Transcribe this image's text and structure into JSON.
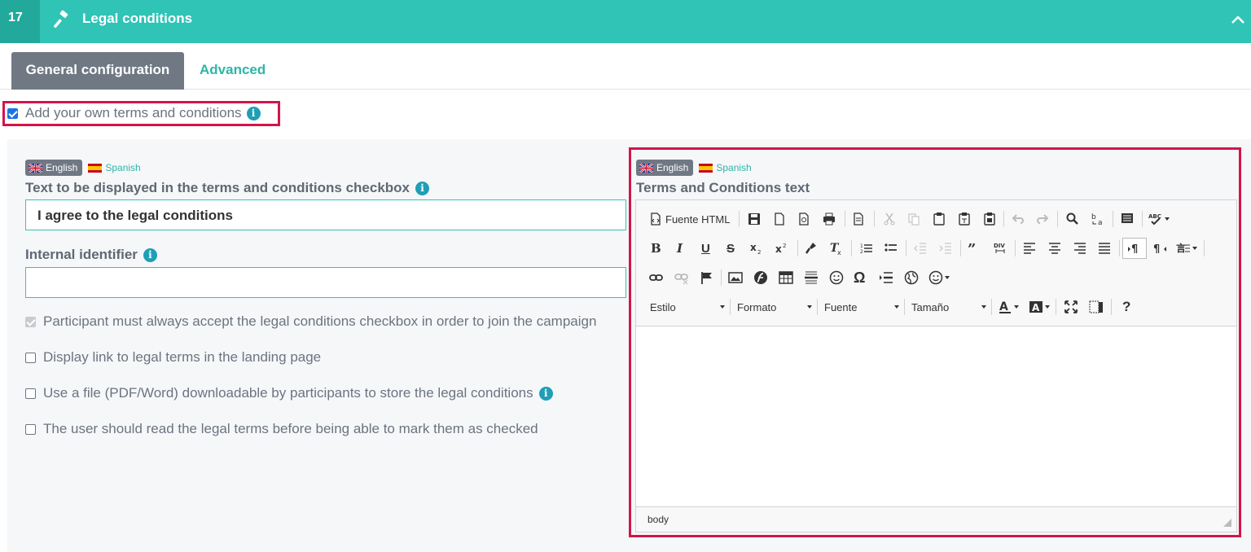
{
  "header": {
    "step": "17",
    "title": "Legal conditions",
    "icon": "gavel-icon",
    "collapse_icon": "chevron-up-icon"
  },
  "tabs": [
    {
      "label": "General configuration",
      "active": true
    },
    {
      "label": "Advanced",
      "active": false
    }
  ],
  "own_terms": {
    "label": "Add your own terms and conditions",
    "checked": true
  },
  "left": {
    "languages": {
      "active": "English",
      "other": "Spanish"
    },
    "checkbox_text": {
      "label": "Text to be displayed in the terms and conditions checkbox",
      "value": "I agree to the legal conditions"
    },
    "internal_id": {
      "label": "Internal identifier",
      "value": ""
    },
    "options": [
      {
        "label": "Participant must always accept the legal conditions checkbox in order to join the campaign",
        "checked": true,
        "disabled": true
      },
      {
        "label": "Display link to legal terms in the landing page",
        "checked": false
      },
      {
        "label": "Use a file (PDF/Word) downloadable by participants to store the legal conditions",
        "checked": false
      },
      {
        "label": "The user should read the legal terms before being able to mark them as checked",
        "checked": false
      }
    ]
  },
  "right": {
    "languages": {
      "active": "English",
      "other": "Spanish"
    },
    "label": "Terms and Conditions text",
    "toolbar": {
      "source_label": "Fuente HTML",
      "combos": [
        "Estilo",
        "Formato",
        "Fuente",
        "Tamaño"
      ]
    },
    "statusbar": "body"
  },
  "colors": {
    "teal": "#2fc4b6",
    "dark_teal": "#22a99c",
    "highlight": "#d3154a",
    "tab_active": "#6f7883"
  }
}
